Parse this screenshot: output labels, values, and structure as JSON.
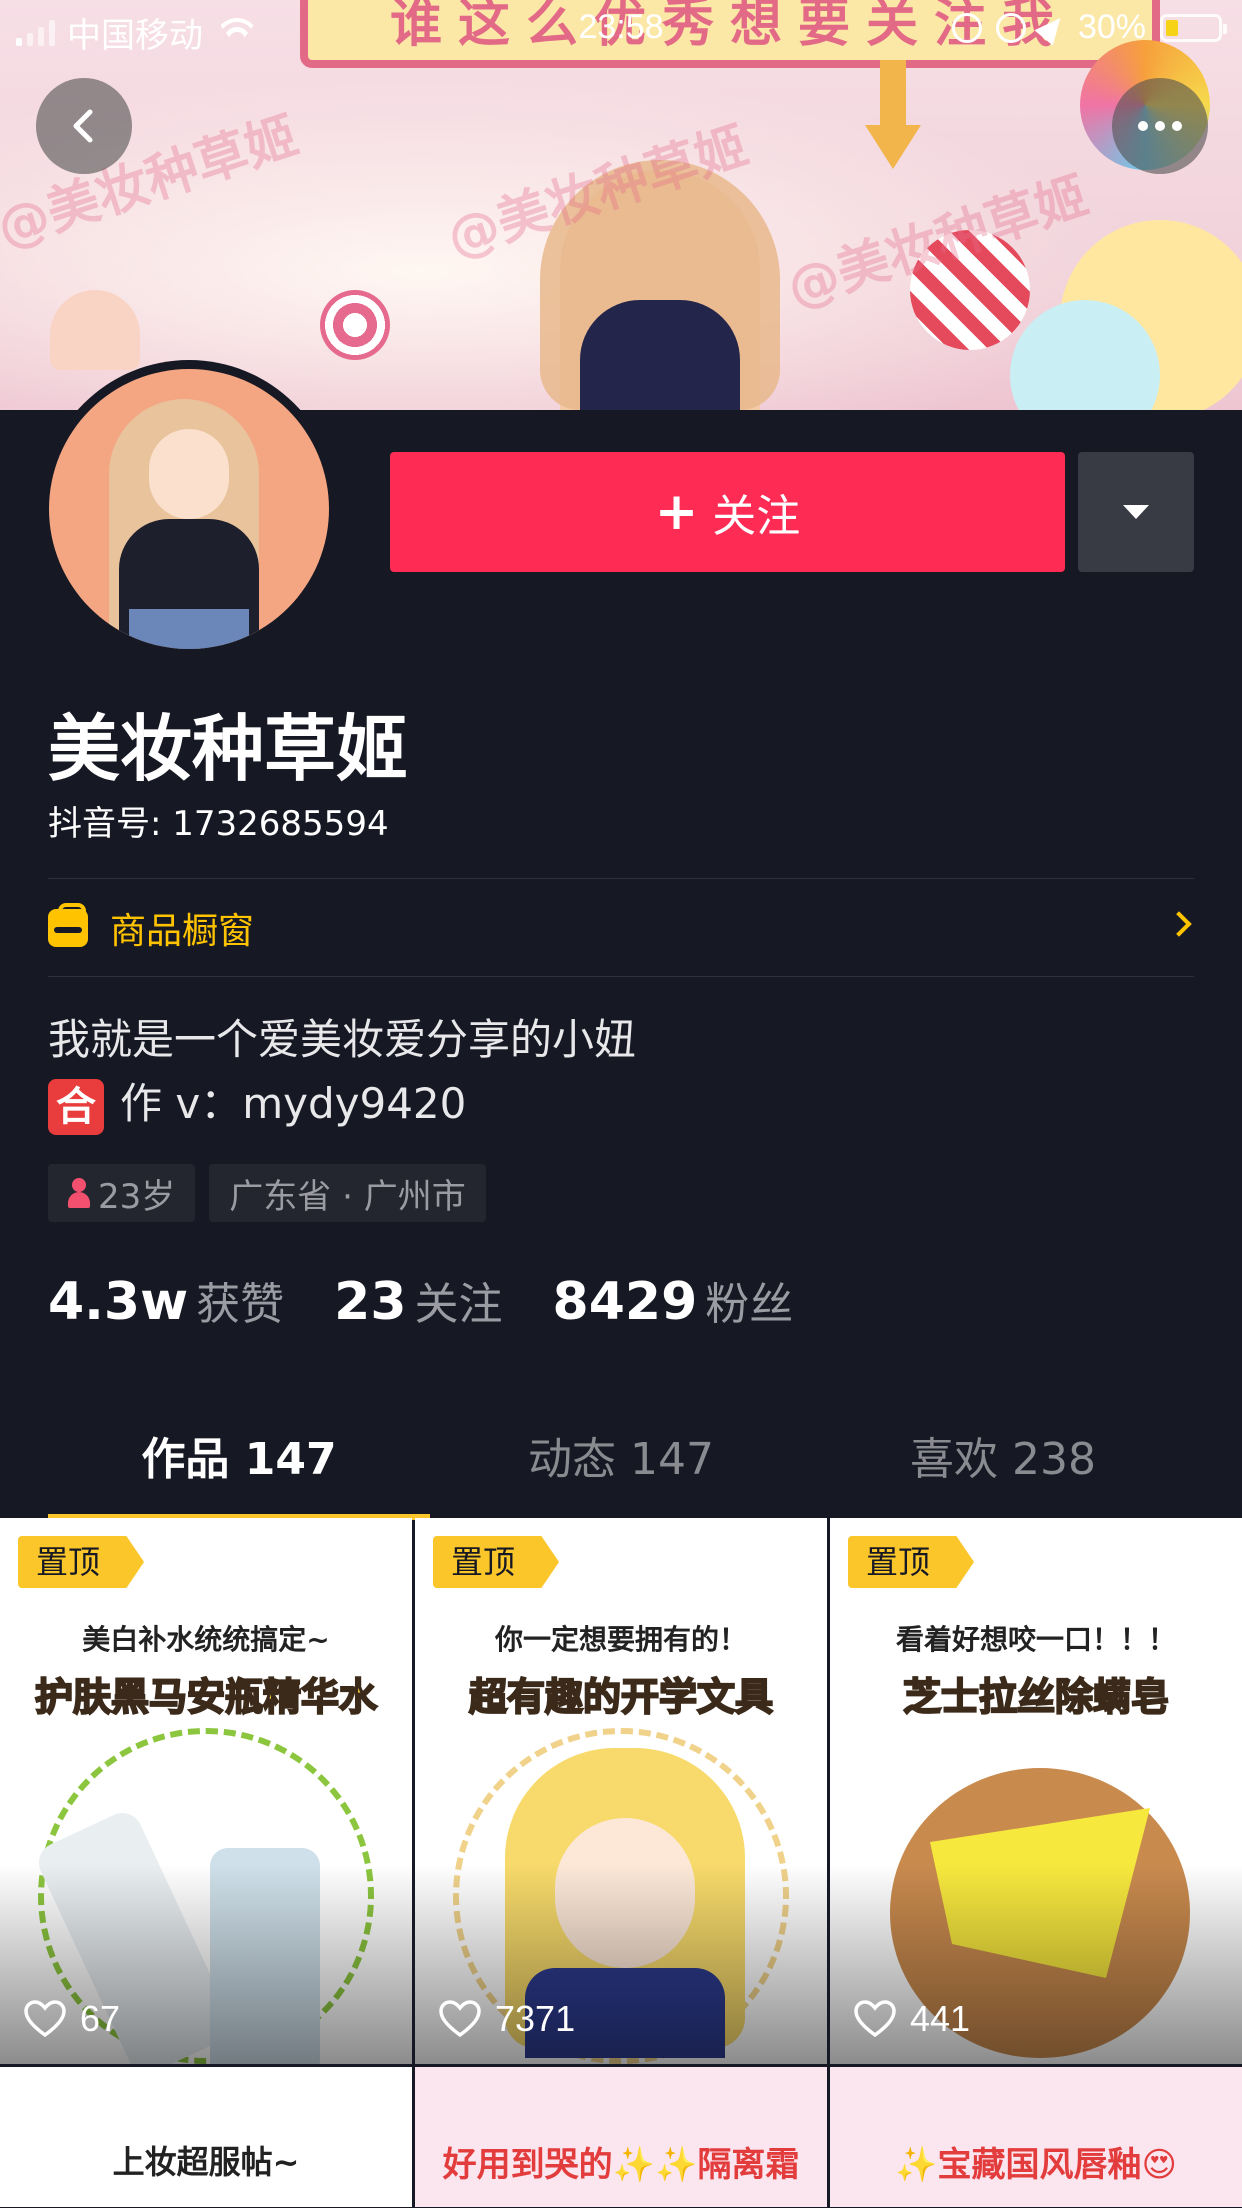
{
  "status_bar": {
    "carrier": "中国移动",
    "time": "23:58",
    "battery": "30%"
  },
  "banner": {
    "sign_text": "谁这么优秀想要关注我",
    "watermark": "@美妆种草姬"
  },
  "profile": {
    "name": "美妆种草姬",
    "douyin_id": "抖音号: 1732685594",
    "follow_label": "关注",
    "shop_label": "商品橱窗",
    "bio_line1": "我就是一个爱美妆爱分享的小妞",
    "bio_line2_badge": "合",
    "bio_line2_text": "作 v：mydy9420",
    "tags": {
      "age": "23岁",
      "location": "广东省 · 广州市"
    },
    "stats": {
      "likes_num": "4.3w",
      "likes_label": "获赞",
      "following_num": "23",
      "following_label": "关注",
      "fans_num": "8429",
      "fans_label": "粉丝"
    }
  },
  "tabs": [
    {
      "label": "作品 147",
      "active": true
    },
    {
      "label": "动态 147",
      "active": false
    },
    {
      "label": "喜欢 238",
      "active": false
    }
  ],
  "videos": [
    {
      "pin": "置顶",
      "caption_small": "美白补水统统搞定~",
      "caption_big": "护肤黑马安瓶精华水",
      "likes": "67"
    },
    {
      "pin": "置顶",
      "caption_small": "你一定想要拥有的！",
      "caption_big": "超有趣的开学文具",
      "likes": "7371"
    },
    {
      "pin": "置顶",
      "caption_small": "看着好想咬一口！！！",
      "caption_big": "芝士拉丝除螨皂",
      "likes": "441"
    },
    {
      "caption": "上妆超服帖~"
    },
    {
      "caption": "好用到哭的✨✨隔离霜"
    },
    {
      "caption": "✨宝藏国风唇釉😍"
    }
  ],
  "colors": {
    "background": "#161823",
    "follow_button": "#fe2c55",
    "accent_yellow": "#fbc62a",
    "shop_yellow": "#ffc300"
  }
}
